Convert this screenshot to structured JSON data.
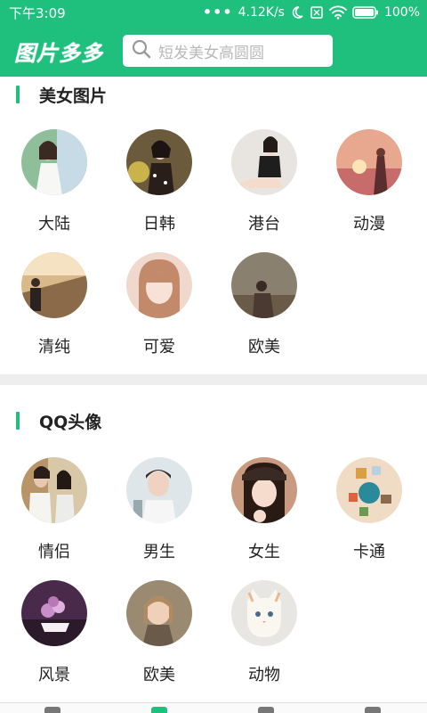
{
  "status_bar": {
    "time": "下午3:09",
    "network_speed": "4.12K/s",
    "battery": "100%",
    "icons": [
      "signal-dots-icon",
      "moon-icon",
      "sim-icon",
      "wifi-icon",
      "battery-icon"
    ]
  },
  "header": {
    "app_title": "图片多多",
    "search_placeholder": "短发美女高圆圆",
    "search_icon": "search-icon"
  },
  "colors": {
    "accent": "#1fbf7d",
    "text": "#222222",
    "divider": "#eeeeee"
  },
  "sections": [
    {
      "title": "美女图片",
      "items": [
        {
          "label": "大陆"
        },
        {
          "label": "日韩"
        },
        {
          "label": "港台"
        },
        {
          "label": "动漫"
        },
        {
          "label": "清纯"
        },
        {
          "label": "可爱"
        },
        {
          "label": "欧美"
        }
      ]
    },
    {
      "title": "QQ头像",
      "items": [
        {
          "label": "情侣"
        },
        {
          "label": "男生"
        },
        {
          "label": "女生"
        },
        {
          "label": "卡通"
        },
        {
          "label": "风景"
        },
        {
          "label": "欧美"
        },
        {
          "label": "动物"
        }
      ]
    }
  ]
}
